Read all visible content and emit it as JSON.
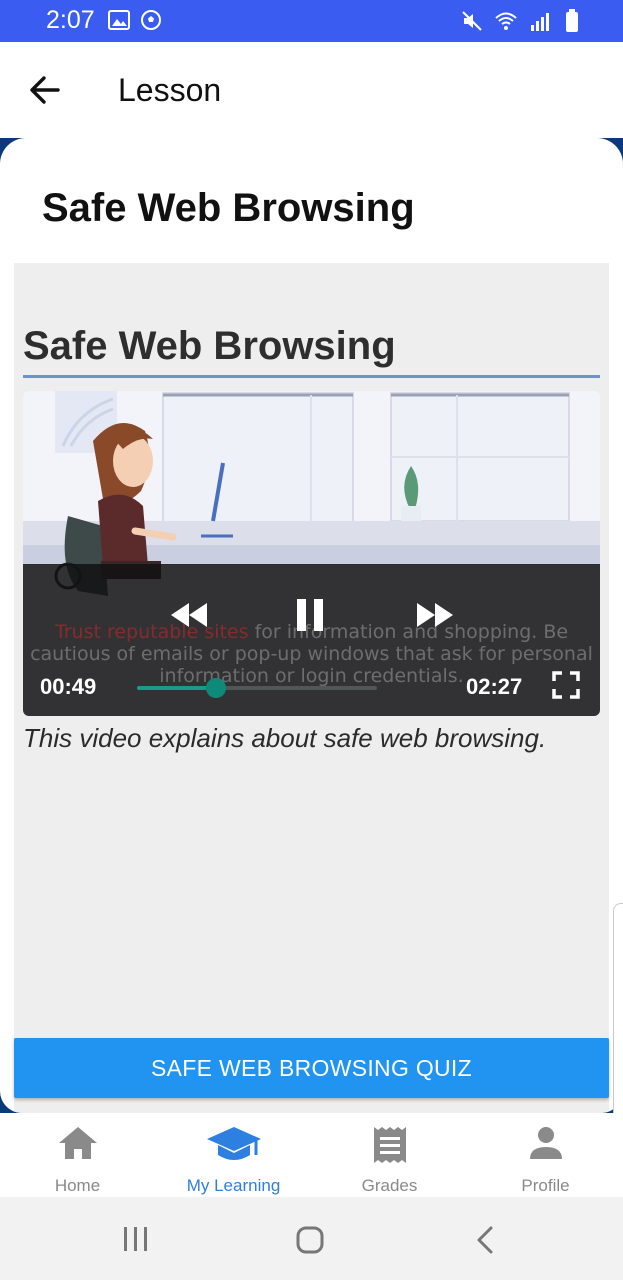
{
  "status_bar": {
    "time": "2:07"
  },
  "app_bar": {
    "title": "Lesson"
  },
  "card": {
    "title": "Safe Web Browsing"
  },
  "content": {
    "heading": "Safe Web Browsing",
    "video": {
      "caption_highlight": "Trust reputable sites",
      "caption_rest": " for information and shopping. Be cautious of emails or pop-up windows that ask for personal information or login credentials.",
      "current_time": "00:49",
      "total_time": "02:27",
      "progress": 0.33
    },
    "description": "This video explains about safe web browsing."
  },
  "quiz_button": {
    "label": "SAFE WEB BROWSING QUIZ"
  },
  "bottom_nav": {
    "items": [
      {
        "label": "Home",
        "icon": "home-icon",
        "active": false
      },
      {
        "label": "My Learning",
        "icon": "graduation-cap-icon",
        "active": true
      },
      {
        "label": "Grades",
        "icon": "receipt-icon",
        "active": false
      },
      {
        "label": "Profile",
        "icon": "person-icon",
        "active": false
      }
    ]
  },
  "colors": {
    "status_bar": "#3a5cf0",
    "accent": "#2193f0",
    "active_nav": "#2d7fe0",
    "seek": "#0e8a7a"
  }
}
